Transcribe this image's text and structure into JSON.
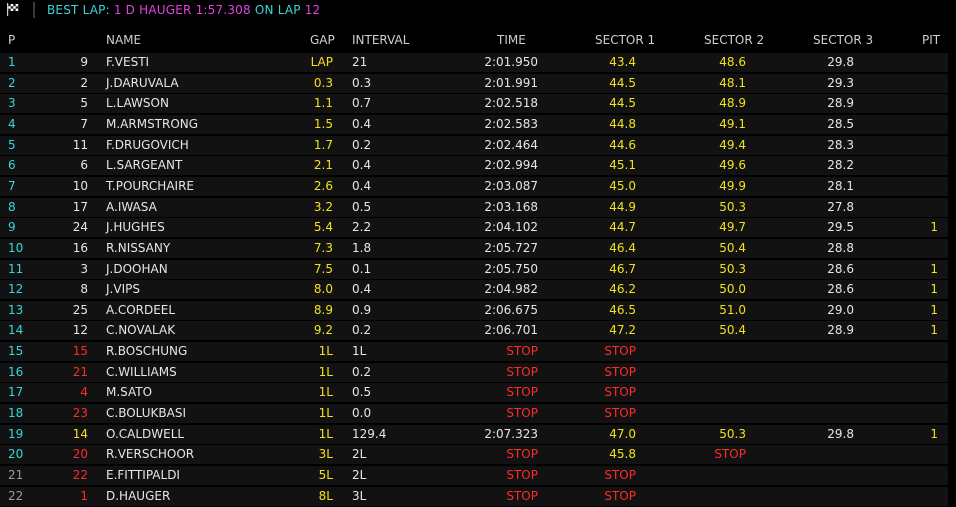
{
  "top_bar": {
    "flag_icon": "chequered-flag-icon",
    "best_lap_label": "BEST LAP:",
    "best_lap_driver": "1 D HAUGER 1:57.308",
    "best_lap_on_lap": "ON LAP",
    "best_lap_number": "12"
  },
  "colors": {
    "cyan": "#38d6d6",
    "magenta": "#e043e0",
    "yellow": "#f2e21b",
    "red": "#ff2a2a",
    "row_bg": "#121212"
  },
  "columns": {
    "pos": "P",
    "name": "NAME",
    "gap": "GAP",
    "interval": "INTERVAL",
    "time": "TIME",
    "sector1": "SECTOR 1",
    "sector2": "SECTOR 2",
    "sector3": "SECTOR 3",
    "pit": "PIT"
  },
  "rows": [
    {
      "pos": "1",
      "num": "9",
      "name": "F.VESTI",
      "gap": "LAP",
      "interval": "21",
      "time": "2:01.950",
      "s1": "43.4",
      "s2": "48.6",
      "s3": "29.8",
      "pit": "",
      "pos_color": "cyan",
      "num_color": "white",
      "s1_color": "yellow",
      "s2_color": "yellow",
      "time_color": "white",
      "s3_color": "white"
    },
    {
      "pos": "2",
      "num": "2",
      "name": "J.DARUVALA",
      "gap": "0.3",
      "interval": "0.3",
      "time": "2:01.991",
      "s1": "44.5",
      "s2": "48.1",
      "s3": "29.3",
      "pit": "",
      "pos_color": "cyan",
      "num_color": "white",
      "s1_color": "yellow",
      "s2_color": "yellow",
      "time_color": "white",
      "s3_color": "white"
    },
    {
      "pos": "3",
      "num": "5",
      "name": "L.LAWSON",
      "gap": "1.1",
      "interval": "0.7",
      "time": "2:02.518",
      "s1": "44.5",
      "s2": "48.9",
      "s3": "28.9",
      "pit": "",
      "pos_color": "cyan",
      "num_color": "white",
      "s1_color": "yellow",
      "s2_color": "yellow",
      "time_color": "white",
      "s3_color": "white"
    },
    {
      "pos": "4",
      "num": "7",
      "name": "M.ARMSTRONG",
      "gap": "1.5",
      "interval": "0.4",
      "time": "2:02.583",
      "s1": "44.8",
      "s2": "49.1",
      "s3": "28.5",
      "pit": "",
      "pos_color": "cyan",
      "num_color": "white",
      "s1_color": "yellow",
      "s2_color": "yellow",
      "time_color": "white",
      "s3_color": "white"
    },
    {
      "pos": "5",
      "num": "11",
      "name": "F.DRUGOVICH",
      "gap": "1.7",
      "interval": "0.2",
      "time": "2:02.464",
      "s1": "44.6",
      "s2": "49.4",
      "s3": "28.3",
      "pit": "",
      "pos_color": "cyan",
      "num_color": "white",
      "s1_color": "yellow",
      "s2_color": "yellow",
      "time_color": "white",
      "s3_color": "white"
    },
    {
      "pos": "6",
      "num": "6",
      "name": "L.SARGEANT",
      "gap": "2.1",
      "interval": "0.4",
      "time": "2:02.994",
      "s1": "45.1",
      "s2": "49.6",
      "s3": "28.2",
      "pit": "",
      "pos_color": "cyan",
      "num_color": "white",
      "s1_color": "yellow",
      "s2_color": "yellow",
      "time_color": "white",
      "s3_color": "white"
    },
    {
      "pos": "7",
      "num": "10",
      "name": "T.POURCHAIRE",
      "gap": "2.6",
      "interval": "0.4",
      "time": "2:03.087",
      "s1": "45.0",
      "s2": "49.9",
      "s3": "28.1",
      "pit": "",
      "pos_color": "cyan",
      "num_color": "white",
      "s1_color": "yellow",
      "s2_color": "yellow",
      "time_color": "white",
      "s3_color": "white"
    },
    {
      "pos": "8",
      "num": "17",
      "name": "A.IWASA",
      "gap": "3.2",
      "interval": "0.5",
      "time": "2:03.168",
      "s1": "44.9",
      "s2": "50.3",
      "s3": "27.8",
      "pit": "",
      "pos_color": "cyan",
      "num_color": "white",
      "s1_color": "yellow",
      "s2_color": "yellow",
      "time_color": "white",
      "s3_color": "white"
    },
    {
      "pos": "9",
      "num": "24",
      "name": "J.HUGHES",
      "gap": "5.4",
      "interval": "2.2",
      "time": "2:04.102",
      "s1": "44.7",
      "s2": "49.7",
      "s3": "29.5",
      "pit": "1",
      "pos_color": "cyan",
      "num_color": "white",
      "s1_color": "yellow",
      "s2_color": "yellow",
      "time_color": "white",
      "s3_color": "white"
    },
    {
      "pos": "10",
      "num": "16",
      "name": "R.NISSANY",
      "gap": "7.3",
      "interval": "1.8",
      "time": "2:05.727",
      "s1": "46.4",
      "s2": "50.4",
      "s3": "28.8",
      "pit": "",
      "pos_color": "cyan",
      "num_color": "white",
      "s1_color": "yellow",
      "s2_color": "yellow",
      "time_color": "white",
      "s3_color": "white"
    },
    {
      "pos": "11",
      "num": "3",
      "name": "J.DOOHAN",
      "gap": "7.5",
      "interval": "0.1",
      "time": "2:05.750",
      "s1": "46.7",
      "s2": "50.3",
      "s3": "28.6",
      "pit": "1",
      "pos_color": "cyan",
      "num_color": "white",
      "s1_color": "yellow",
      "s2_color": "yellow",
      "time_color": "white",
      "s3_color": "white"
    },
    {
      "pos": "12",
      "num": "8",
      "name": "J.VIPS",
      "gap": "8.0",
      "interval": "0.4",
      "time": "2:04.982",
      "s1": "46.2",
      "s2": "50.0",
      "s3": "28.6",
      "pit": "1",
      "pos_color": "cyan",
      "num_color": "white",
      "s1_color": "yellow",
      "s2_color": "yellow",
      "time_color": "white",
      "s3_color": "white"
    },
    {
      "pos": "13",
      "num": "25",
      "name": "A.CORDEEL",
      "gap": "8.9",
      "interval": "0.9",
      "time": "2:06.675",
      "s1": "46.5",
      "s2": "51.0",
      "s3": "29.0",
      "pit": "1",
      "pos_color": "cyan",
      "num_color": "white",
      "s1_color": "yellow",
      "s2_color": "yellow",
      "time_color": "white",
      "s3_color": "white"
    },
    {
      "pos": "14",
      "num": "12",
      "name": "C.NOVALAK",
      "gap": "9.2",
      "interval": "0.2",
      "time": "2:06.701",
      "s1": "47.2",
      "s2": "50.4",
      "s3": "28.9",
      "pit": "1",
      "pos_color": "cyan",
      "num_color": "white",
      "s1_color": "yellow",
      "s2_color": "yellow",
      "time_color": "white",
      "s3_color": "white"
    },
    {
      "pos": "15",
      "num": "15",
      "name": "R.BOSCHUNG",
      "gap": "1L",
      "interval": "1L",
      "time": "STOP",
      "s1": "STOP",
      "s2": "",
      "s3": "",
      "pit": "",
      "pos_color": "cyan",
      "num_color": "red",
      "s1_color": "red",
      "s2_color": "yellow",
      "time_color": "red",
      "s3_color": "white"
    },
    {
      "pos": "16",
      "num": "21",
      "name": "C.WILLIAMS",
      "gap": "1L",
      "interval": "0.2",
      "time": "STOP",
      "s1": "STOP",
      "s2": "",
      "s3": "",
      "pit": "",
      "pos_color": "cyan",
      "num_color": "red",
      "s1_color": "red",
      "s2_color": "yellow",
      "time_color": "red",
      "s3_color": "white"
    },
    {
      "pos": "17",
      "num": "4",
      "name": "M.SATO",
      "gap": "1L",
      "interval": "0.5",
      "time": "STOP",
      "s1": "STOP",
      "s2": "",
      "s3": "",
      "pit": "",
      "pos_color": "cyan",
      "num_color": "red",
      "s1_color": "red",
      "s2_color": "yellow",
      "time_color": "red",
      "s3_color": "white"
    },
    {
      "pos": "18",
      "num": "23",
      "name": "C.BOLUKBASI",
      "gap": "1L",
      "interval": "0.0",
      "time": "STOP",
      "s1": "STOP",
      "s2": "",
      "s3": "",
      "pit": "",
      "pos_color": "cyan",
      "num_color": "red",
      "s1_color": "red",
      "s2_color": "yellow",
      "time_color": "red",
      "s3_color": "white"
    },
    {
      "pos": "19",
      "num": "14",
      "name": "O.CALDWELL",
      "gap": "1L",
      "interval": "129.4",
      "time": "2:07.323",
      "s1": "47.0",
      "s2": "50.3",
      "s3": "29.8",
      "pit": "1",
      "pos_color": "cyan",
      "num_color": "yellow",
      "s1_color": "yellow",
      "s2_color": "yellow",
      "time_color": "white",
      "s3_color": "white"
    },
    {
      "pos": "20",
      "num": "20",
      "name": "R.VERSCHOOR",
      "gap": "3L",
      "interval": "2L",
      "time": "STOP",
      "s1": "45.8",
      "s2": "STOP",
      "s3": "",
      "pit": "",
      "pos_color": "cyan",
      "num_color": "red",
      "s1_color": "yellow",
      "s2_color": "red",
      "time_color": "red",
      "s3_color": "white"
    },
    {
      "pos": "21",
      "num": "22",
      "name": "E.FITTIPALDI",
      "gap": "5L",
      "interval": "2L",
      "time": "STOP",
      "s1": "STOP",
      "s2": "",
      "s3": "",
      "pit": "",
      "pos_color": "grey",
      "num_color": "red",
      "s1_color": "red",
      "s2_color": "yellow",
      "time_color": "red",
      "s3_color": "white"
    },
    {
      "pos": "22",
      "num": "1",
      "name": "D.HAUGER",
      "gap": "8L",
      "interval": "3L",
      "time": "STOP",
      "s1": "STOP",
      "s2": "",
      "s3": "",
      "pit": "",
      "pos_color": "grey",
      "num_color": "red",
      "s1_color": "red",
      "s2_color": "yellow",
      "time_color": "red",
      "s3_color": "white"
    }
  ]
}
